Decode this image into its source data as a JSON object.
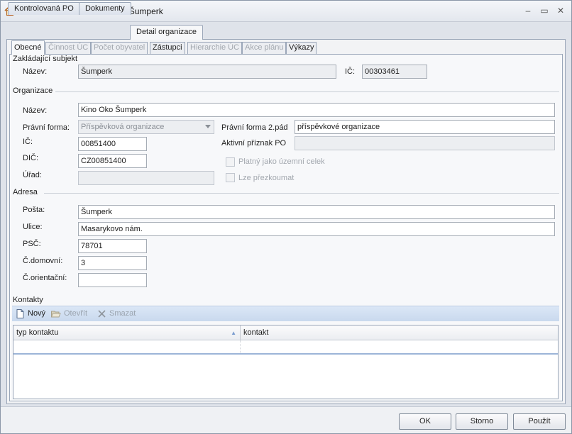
{
  "window": {
    "title": "Kontrolovaná PO - Kino Oko Šumperk",
    "icon": "home-icon",
    "controls": [
      "–",
      "▭",
      "✕"
    ]
  },
  "outer_tabs": [
    "Kontrolovaná PO",
    "Dokumenty",
    "Detail organizace"
  ],
  "inner_tabs": [
    "Obecné",
    "Činnost ÚC",
    "Počet obyvatel",
    "Zástupci",
    "Hierarchie ÚC",
    "Akce plánu",
    "Výkazy"
  ],
  "zakladajici": {
    "section": "Zakládající subjekt",
    "nazev_label": "Název:",
    "nazev_value": "Šumperk",
    "ic_label": "IČ:",
    "ic_value": "00303461"
  },
  "organizace": {
    "section": "Organizace",
    "nazev_label": "Název:",
    "nazev_value": "Kino Oko Šumperk",
    "pravni_forma_label": "Právní forma:",
    "pravni_forma_value": "Příspěvková organizace",
    "pravni_forma2_label": "Právní forma 2.pád",
    "pravni_forma2_value": "příspěvkové organizace",
    "ic_label": "IČ:",
    "ic_value": "00851400",
    "aktivni_label": "Aktivní příznak PO",
    "aktivni_value": "",
    "dic_label": "DIČ:",
    "dic_value": "CZ00851400",
    "platny_label": "Platný jako územní celek",
    "uran_label": "Úřad:",
    "urad_value": "",
    "prezkoumat_label": "Lze přezkoumat"
  },
  "adresa": {
    "section": "Adresa",
    "posta_label": "Pošta:",
    "posta_value": "Šumperk",
    "ulice_label": "Ulice:",
    "ulice_value": "Masarykovo nám.",
    "psc_label": "PSČ:",
    "psc_value": "78701",
    "cdomovni_label": "Č.domovní:",
    "cdomovni_value": "3",
    "corientacni_label": "Č.orientační:",
    "corientacni_value": ""
  },
  "kontakty": {
    "section": "Kontakty",
    "toolbar": {
      "new": "Nový",
      "open": "Otevřít",
      "delete": "Smazat"
    },
    "columns": [
      "typ kontaktu",
      "kontakt"
    ]
  },
  "footer": {
    "ok": "OK",
    "cancel": "Storno",
    "apply": "Použít"
  }
}
